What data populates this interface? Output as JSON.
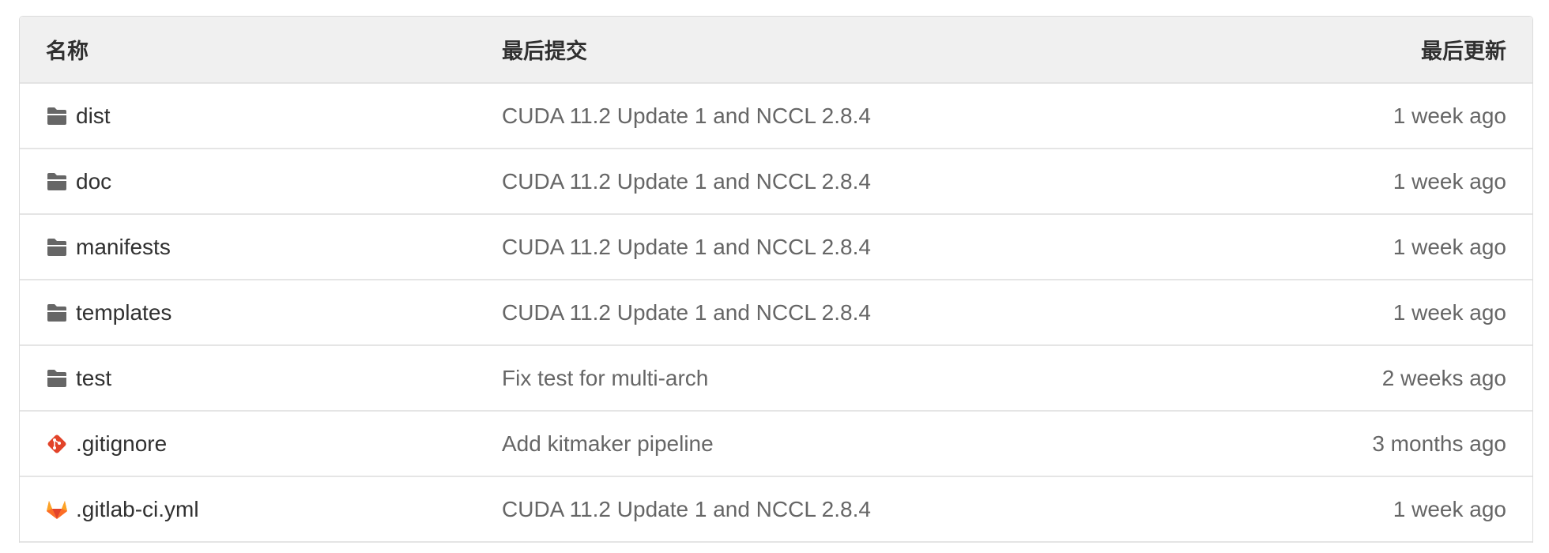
{
  "header": {
    "name": "名称",
    "last_commit": "最后提交",
    "last_update": "最后更新"
  },
  "rows": [
    {
      "icon": "folder-icon",
      "name": "dist",
      "commit": "CUDA 11.2 Update 1 and NCCL 2.8.4",
      "time": "1 week ago"
    },
    {
      "icon": "folder-icon",
      "name": "doc",
      "commit": "CUDA 11.2 Update 1 and NCCL 2.8.4",
      "time": "1 week ago"
    },
    {
      "icon": "folder-icon",
      "name": "manifests",
      "commit": "CUDA 11.2 Update 1 and NCCL 2.8.4",
      "time": "1 week ago"
    },
    {
      "icon": "folder-icon",
      "name": "templates",
      "commit": "CUDA 11.2 Update 1 and NCCL 2.8.4",
      "time": "1 week ago"
    },
    {
      "icon": "folder-icon",
      "name": "test",
      "commit": "Fix test for multi-arch",
      "time": "2 weeks ago"
    },
    {
      "icon": "git-file-icon",
      "name": ".gitignore",
      "commit": "Add kitmaker pipeline",
      "time": "3 months ago"
    },
    {
      "icon": "gitlab-icon",
      "name": ".gitlab-ci.yml",
      "commit": "CUDA 11.2 Update 1 and NCCL 2.8.4",
      "time": "1 week ago"
    }
  ],
  "colors": {
    "folder": "#666666",
    "git": "#e24329",
    "gitlab_orange": "#fc6d26",
    "gitlab_dark": "#e24329",
    "gitlab_light": "#fca326"
  }
}
